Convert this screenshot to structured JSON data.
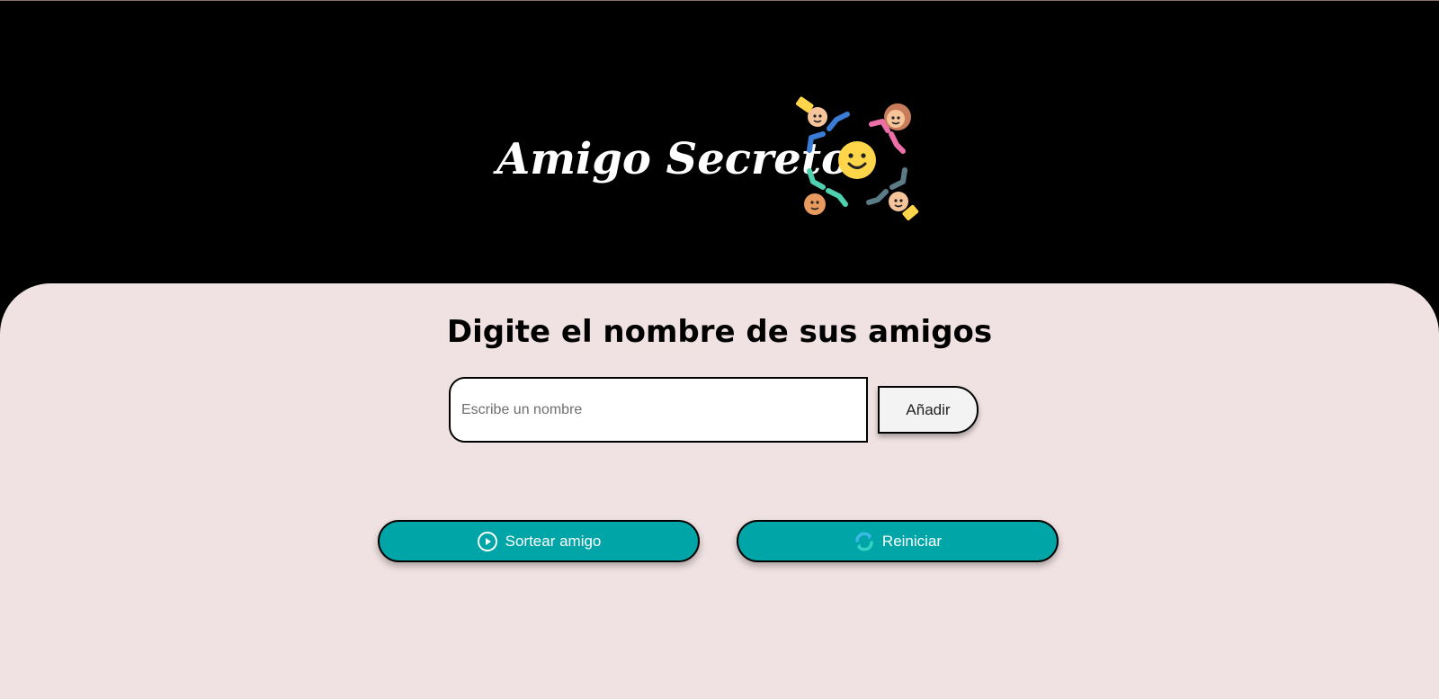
{
  "header": {
    "title": "Amigo Secreto",
    "logo_icon": "friends-circle-icon"
  },
  "main": {
    "section_title": "Digite el nombre de sus amigos",
    "input": {
      "placeholder": "Escribe un nombre",
      "value": ""
    },
    "add_button_label": "Añadir",
    "draw_button": {
      "label": "Sortear amigo",
      "icon": "play-circle-icon"
    },
    "reset_button": {
      "label": "Reiniciar",
      "icon": "refresh-icon"
    }
  },
  "colors": {
    "header_background": "#000000",
    "main_background": "#f0e1e2",
    "accent_button": "#00a5a8",
    "add_button": "#f3f3f3"
  }
}
